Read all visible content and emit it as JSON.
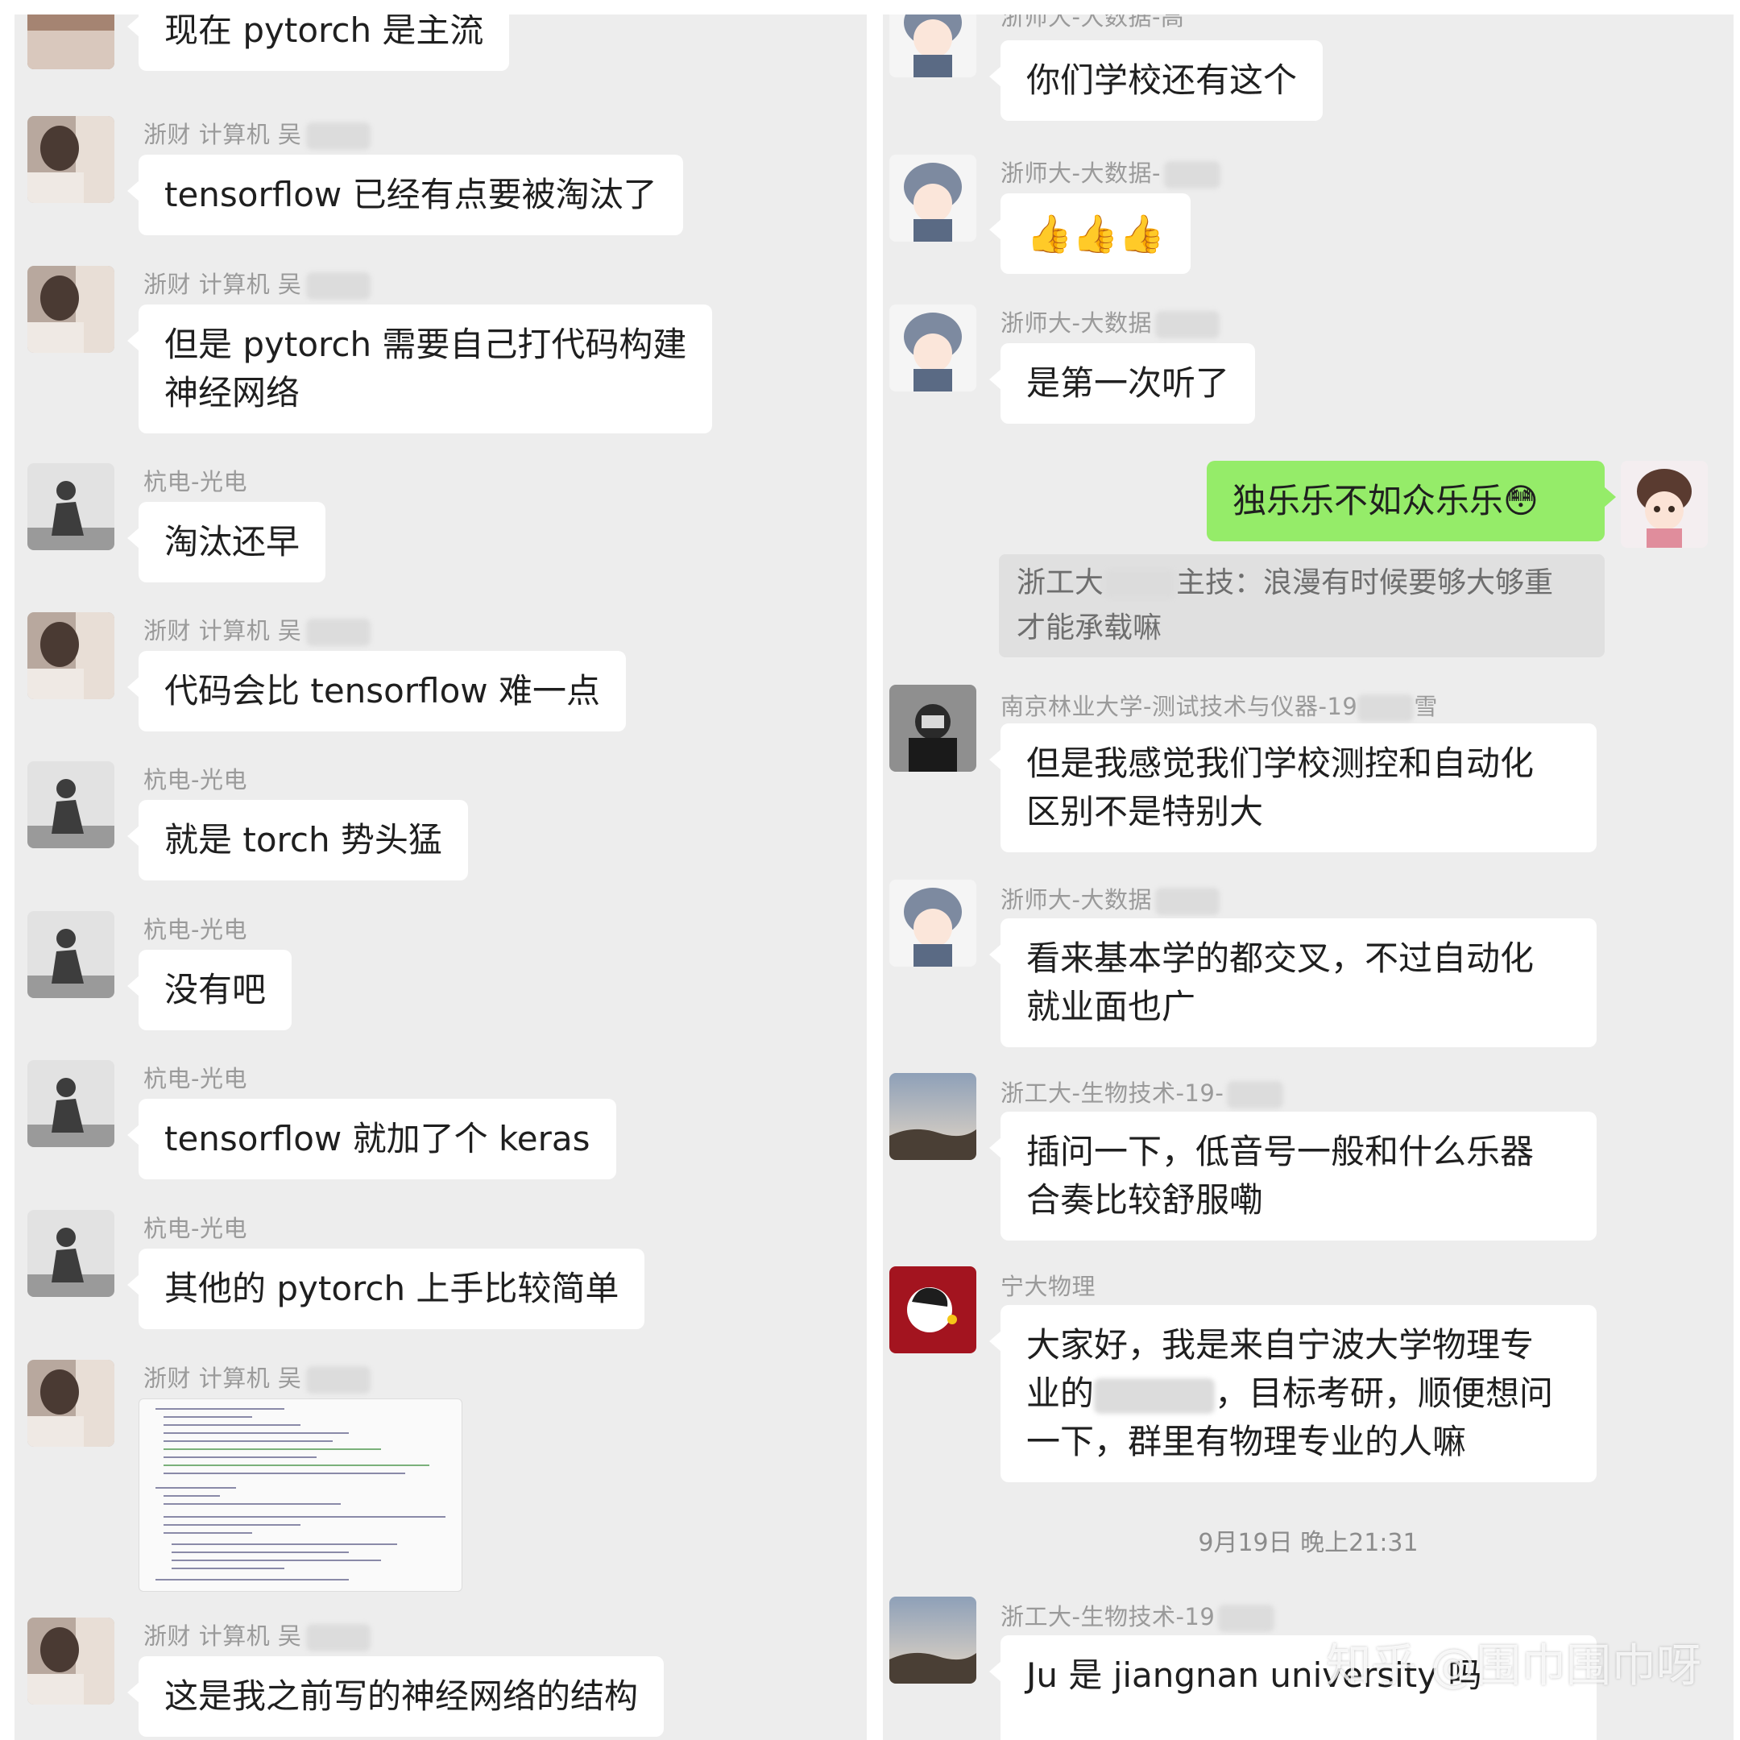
{
  "left_panel": {
    "m1": {
      "text": "现在 pytorch 是主流"
    },
    "m2": {
      "sender": "浙财 计算机 吴",
      "text": "tensorflow 已经有点要被淘汰了"
    },
    "m3": {
      "sender": "浙财 计算机 吴",
      "line1": "但是 pytorch 需要自己打代码构建",
      "line2": "神经网络"
    },
    "m4": {
      "sender": "杭电-光电",
      "text": "淘汰还早"
    },
    "m5": {
      "sender": "浙财 计算机 吴",
      "text": "代码会比 tensorflow 难一点"
    },
    "m6": {
      "sender": "杭电-光电",
      "text": "就是 torch 势头猛"
    },
    "m7": {
      "sender": "杭电-光电",
      "text": "没有吧"
    },
    "m8": {
      "sender": "杭电-光电",
      "text": "tensorflow 就加了个 keras"
    },
    "m9": {
      "sender": "杭电-光电",
      "text": "其他的 pytorch 上手比较简单"
    },
    "m10": {
      "sender": "浙财 计算机 吴",
      "image": "code-screenshot"
    },
    "m11": {
      "sender": "浙财 计算机 吴",
      "text": "这是我之前写的神经网络的结构"
    }
  },
  "right_panel": {
    "r1": {
      "sender": "浙师大-大数据-高",
      "text": "你们学校还有这个"
    },
    "r2": {
      "sender": "浙师大-大数据-",
      "emoji": "👍👍👍"
    },
    "r3": {
      "sender": "浙师大-大数据",
      "text": "是第一次听了"
    },
    "r4": {
      "text": "独乐乐不如众乐乐",
      "emoji": "😳"
    },
    "r4_quote": {
      "line1": "浙工大",
      "line1b": "主技：浪漫有时候要够大够重",
      "line2": "才能承载嘛"
    },
    "r5": {
      "sender": "南京林业大学-测试技术与仪器-19",
      "sender_tail": "雪",
      "line1": "但是我感觉我们学校测控和自动化",
      "line2": "区别不是特别大"
    },
    "r6": {
      "sender": "浙师大-大数据",
      "line1": "看来基本学的都交叉，不过自动化",
      "line2": "就业面也广"
    },
    "r7": {
      "sender": "浙工大-生物技术-19-",
      "line1": "插问一下，低音号一般和什么乐器",
      "line2": "合奏比较舒服嘞"
    },
    "r8": {
      "sender": "宁大物理",
      "line1": "大家好，我是来自宁波大学物理专",
      "line2a": "业的",
      "line2b": "，目标考研，顺便想问",
      "line3": "一下，群里有物理专业的人嘛"
    },
    "timestamp": "9月19日 晚上21:31",
    "r9": {
      "sender": "浙工大-生物技术-19",
      "text": "Ju 是 jiangnan university 吗"
    }
  },
  "watermark": "知乎 @围巾围巾呀",
  "colors": {
    "background": "#ededed",
    "bubble": "#ffffff",
    "my_bubble": "#95ec69",
    "sender_text": "#9a9a9a",
    "quote_bg": "#e0e0e0"
  },
  "icons": {
    "left_avatar_a": "person-photo-avatar",
    "left_avatar_b": "silhouette-avatar",
    "right_avatar_a": "cartoon-girl-avatar",
    "right_avatar_b": "photo-avatar",
    "right_avatar_c": "landscape-avatar",
    "right_avatar_d": "red-cartoon-avatar"
  }
}
